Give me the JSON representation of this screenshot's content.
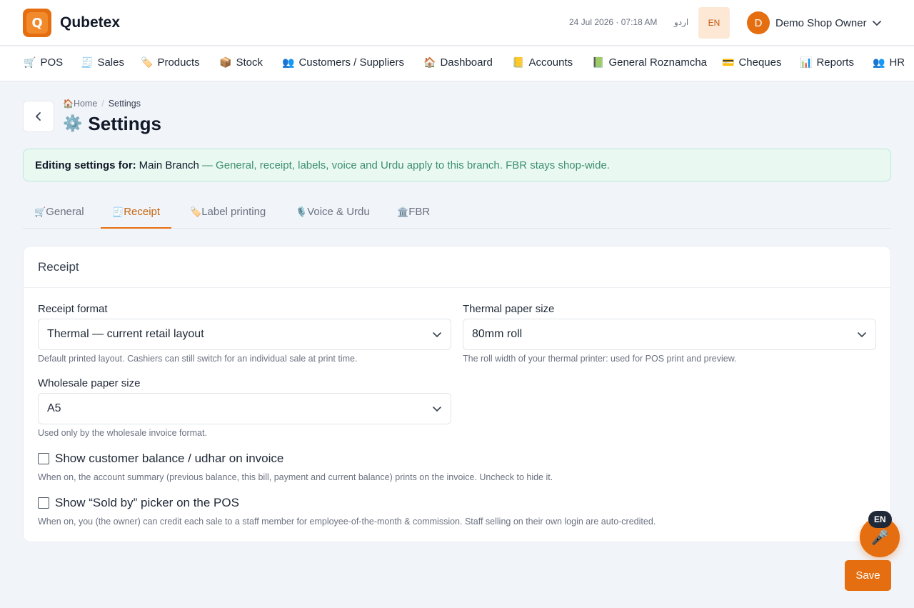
{
  "header": {
    "brand_initial": "Q",
    "brand_name": "Qubetex",
    "datetime": "24 Jul 2026 · 07:18 AM",
    "lang_urdu": "اردو",
    "lang_en": "EN",
    "user_initial": "D",
    "user_name": "Demo Shop Owner"
  },
  "nav": {
    "items": [
      {
        "icon": "🛒",
        "label": "POS"
      },
      {
        "icon": "🧾",
        "label": "Sales"
      },
      {
        "icon": "🏷️",
        "label": "Products"
      },
      {
        "icon": "📦",
        "label": "Stock"
      },
      {
        "icon": "👥",
        "label": "Customers / Suppliers"
      },
      {
        "icon": "🏠",
        "label": "Dashboard"
      },
      {
        "icon": "📒",
        "label": "Accounts"
      },
      {
        "icon": "📗",
        "label": "General Roznamcha"
      },
      {
        "icon": "💳",
        "label": "Cheques"
      },
      {
        "icon": "📊",
        "label": "Reports"
      },
      {
        "icon": "👥",
        "label": "HR"
      }
    ]
  },
  "breadcrumb": {
    "home_icon": "🏠",
    "home": "Home",
    "separator": "/",
    "current": "Settings"
  },
  "page": {
    "title_icon": "⚙️",
    "title": "Settings"
  },
  "banner": {
    "label": "Editing settings for:",
    "branch": "Main Branch",
    "text": "— General, receipt, labels, voice and Urdu apply to this branch. FBR stays shop-wide."
  },
  "tabs": [
    {
      "icon": "🛒",
      "label": "General"
    },
    {
      "icon": "🧾",
      "label": "Receipt"
    },
    {
      "icon": "🏷️",
      "label": "Label printing"
    },
    {
      "icon": "🎙️",
      "label": "Voice & Urdu"
    },
    {
      "icon": "🏛️",
      "label": "FBR"
    }
  ],
  "receipt": {
    "heading": "Receipt",
    "format": {
      "label": "Receipt format",
      "value": "Thermal — current retail layout",
      "help": "Default printed layout. Cashiers can still switch for an individual sale at print time."
    },
    "thermal": {
      "label": "Thermal paper size",
      "value": "80mm roll",
      "help": "The roll width of your thermal printer: used for POS print and preview."
    },
    "wholesale": {
      "label": "Wholesale paper size",
      "value": "A5",
      "help": "Used only by the wholesale invoice format."
    },
    "show_balance": {
      "label": "Show customer balance / udhar on invoice",
      "checked": false,
      "help": "When on, the account summary (previous balance, this bill, payment and current balance) prints on the invoice. Uncheck to hide it."
    },
    "sold_by": {
      "label": "Show “Sold by” picker on the POS",
      "checked": false,
      "help": "When on, you (the owner) can credit each sale to a staff member for employee-of-the-month & commission. Staff selling on their own login are auto-credited."
    }
  },
  "voice": {
    "badge": "EN",
    "icon": "🎤"
  },
  "actions": {
    "save": "Save"
  },
  "colors": {
    "accent": "#e56f10",
    "banner_bg": "#e9f9f2",
    "banner_text": "#3f8f6e",
    "page_bg": "#f1f4f9"
  }
}
